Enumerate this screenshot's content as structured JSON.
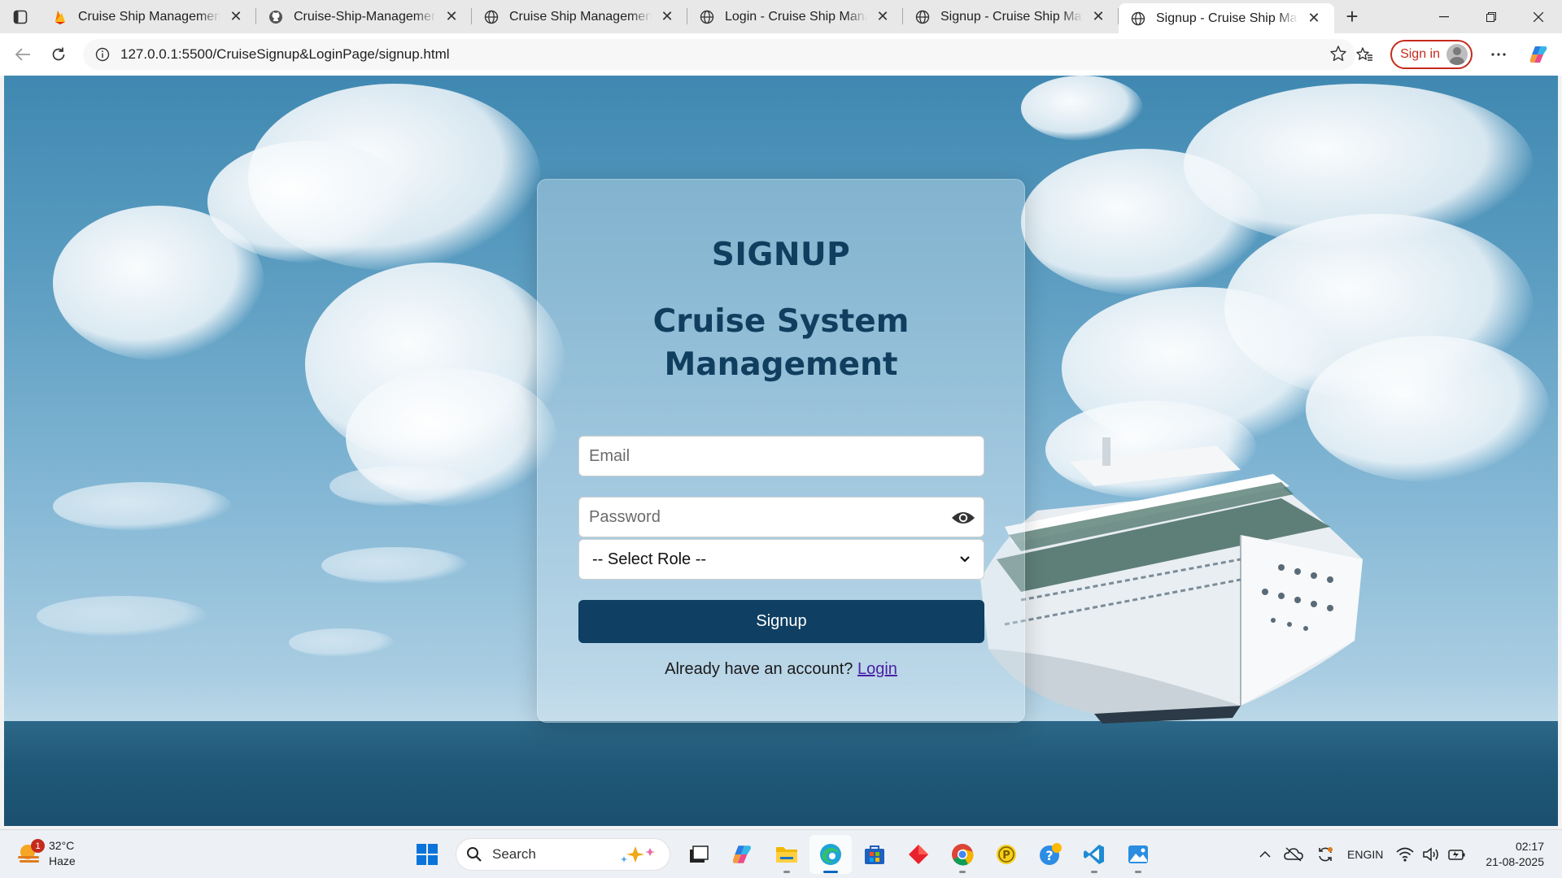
{
  "browser": {
    "tabs": [
      {
        "title": "Cruise Ship Management Sy",
        "icon": "firebase-icon"
      },
      {
        "title": "Cruise-Ship-Management-Sy",
        "icon": "github-icon"
      },
      {
        "title": "Cruise Ship Management",
        "icon": "globe-icon"
      },
      {
        "title": "Login - Cruise Ship Manager",
        "icon": "globe-icon"
      },
      {
        "title": "Signup - Cruise Ship Manage",
        "icon": "globe-icon"
      },
      {
        "title": "Signup - Cruise Ship Manag",
        "icon": "globe-icon",
        "active": true
      }
    ],
    "url": "127.0.0.1:5500/CruiseSignup&LoginPage/signup.html",
    "signin_label": "Sign in"
  },
  "page": {
    "heading": "SIGNUP",
    "subtitle_line1": "Cruise System",
    "subtitle_line2": "Management",
    "email_placeholder": "Email",
    "password_placeholder": "Password",
    "role_select_value": "-- Select Role --",
    "submit_label": "Signup",
    "footer_text": "Already have an account?",
    "login_link": "Login",
    "accent_color": "#0f3f62"
  },
  "taskbar": {
    "weather_temp": "32°C",
    "weather_desc": "Haze",
    "weather_badge": "1",
    "search_label": "Search",
    "lang_line1": "ENG",
    "lang_line2": "IN",
    "time": "02:17",
    "date": "21-08-2025"
  }
}
